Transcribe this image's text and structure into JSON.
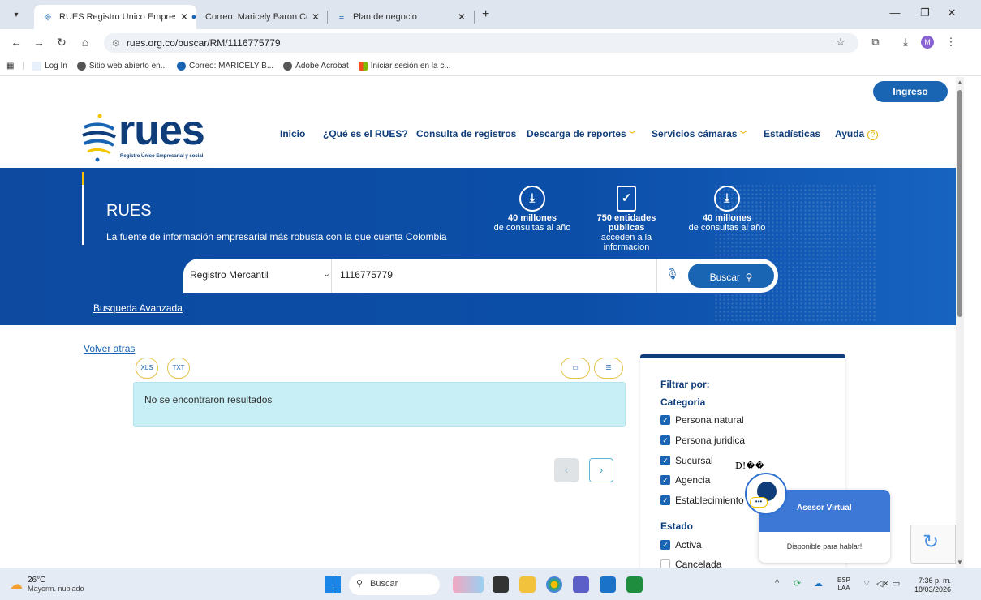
{
  "browser": {
    "tabs": [
      {
        "title": "RUES Registro Unico Empresari",
        "active": true
      },
      {
        "title": "Correo: Maricely Baron Contrer",
        "active": false
      },
      {
        "title": "Plan de negocio",
        "active": false
      }
    ],
    "url": "rues.org.co/buscar/RM/1116775779",
    "bookmarks": [
      "Log In",
      "Sitio web abierto en...",
      "Correo: MARICELY B...",
      "Adobe Acrobat",
      "Iniciar sesión en la c..."
    ],
    "profile_initial": "M"
  },
  "header": {
    "login_label": "Ingreso",
    "logo_text": "rues",
    "logo_subtitle": "Registro Único Empresarial y social",
    "nav": [
      "Inicio",
      "¿Qué es el RUES?",
      "Consulta de registros",
      "Descarga de reportes",
      "Servicios cámaras",
      "Estadísticas",
      "Ayuda"
    ],
    "help_icon_glyph": "?"
  },
  "hero": {
    "title": "RUES",
    "subtitle": "La fuente de información empresarial más robusta con la que cuenta Colombia",
    "stats": [
      {
        "big": "40 millones",
        "small": "de consultas al año",
        "icon": "download-icon"
      },
      {
        "big": "750 entidades públicas",
        "small": "acceden a la informacion",
        "icon": "document-check-icon"
      },
      {
        "big": "40 millones",
        "small": "de consultas al año",
        "icon": "download-icon"
      }
    ]
  },
  "search": {
    "registry_type": "Registro Mercantil",
    "query": "1116775779",
    "button_label": "Buscar",
    "advanced_link": "Busqueda Avanzada"
  },
  "results": {
    "back_link": "Volver atras",
    "export_icons": [
      "XLS",
      "TXT"
    ],
    "message": "No se encontraron resultados"
  },
  "filters": {
    "title": "Filtrar por:",
    "category_heading": "Categoria",
    "categories": [
      {
        "label": "Persona natural",
        "checked": true
      },
      {
        "label": "Persona juridica",
        "checked": true
      },
      {
        "label": "Sucursal",
        "checked": true
      },
      {
        "label": "Agencia",
        "checked": true
      },
      {
        "label": "Establecimiento",
        "checked": true
      }
    ],
    "status_heading": "Estado",
    "statuses": [
      {
        "label": "Activa",
        "checked": true
      },
      {
        "label": "Cancelada",
        "checked": false
      }
    ],
    "glitch_text": "D!��"
  },
  "chat": {
    "title": "Asesor Virtual",
    "status": "Disponible para hablar!"
  },
  "taskbar": {
    "temperature": "26°C",
    "weather": "Mayorm. nublado",
    "search_label": "Buscar",
    "lang_top": "ESP",
    "lang_bottom": "LAA",
    "time": "7:36 p. m.",
    "date": "18/03/2026"
  },
  "colors": {
    "brand_blue": "#0f3d7a",
    "accent_blue": "#1a65b3",
    "hero_blue": "#0d4aa0",
    "accent_yellow": "#f5c500",
    "result_bg": "#c8eff6"
  }
}
